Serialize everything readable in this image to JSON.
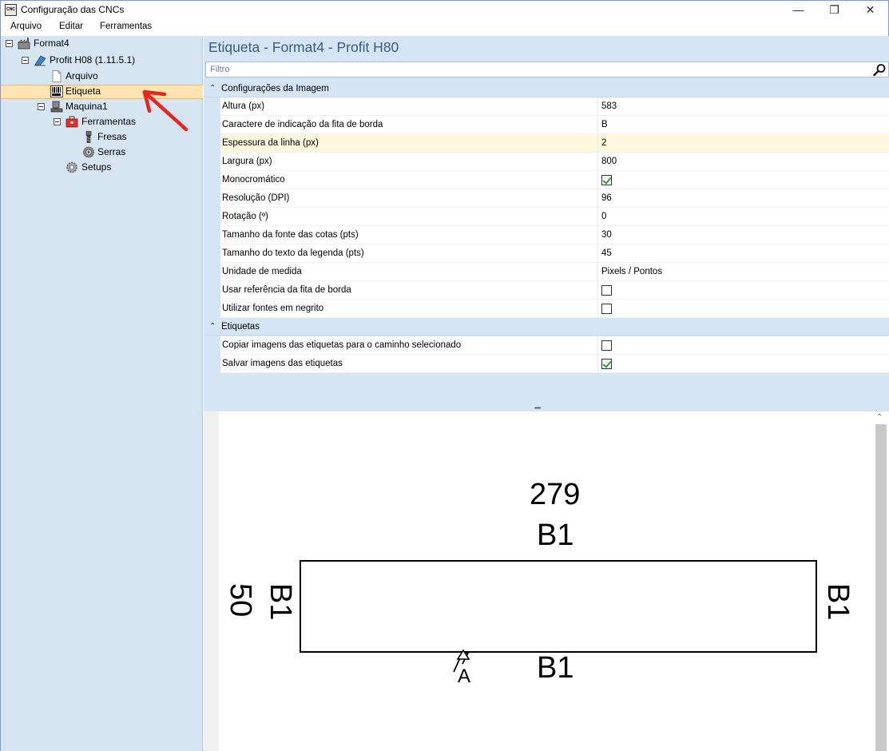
{
  "window": {
    "title": "Configuração das CNCs",
    "icon_text": "CNC"
  },
  "menu": {
    "items": [
      "Arquivo",
      "Editar",
      "Ferramentas"
    ]
  },
  "tree": {
    "root": "Format4",
    "machine_profile": "Profit H08 (1.11.5.1)",
    "arquivo": "Arquivo",
    "etiqueta": "Etiqueta",
    "maquina": "Maquina1",
    "ferramentas": "Ferramentas",
    "fresas": "Fresas",
    "serras": "Serras",
    "setups": "Setups"
  },
  "panel": {
    "title": "Etiqueta - Format4 - Profit H80",
    "filter_placeholder": "Filtro"
  },
  "properties": {
    "categories": [
      "Configurações da Imagem",
      "Etiquetas"
    ],
    "image": [
      {
        "name": "Altura (px)",
        "value": "583"
      },
      {
        "name": "Caractere de indicação da fita de borda",
        "value": "B"
      },
      {
        "name": "Espessura da linha (px)",
        "value": "2"
      },
      {
        "name": "Largura (px)",
        "value": "800"
      },
      {
        "name": "Monocromático",
        "value": ""
      },
      {
        "name": "Resolução (DPI)",
        "value": "96"
      },
      {
        "name": "Rotação (º)",
        "value": "0"
      },
      {
        "name": "Tamanho da fonte das cotas (pts)",
        "value": "30"
      },
      {
        "name": "Tamanho do texto da legenda (pts)",
        "value": "45"
      },
      {
        "name": "Unidade de medida",
        "value": "Pixels / Pontos"
      },
      {
        "name": "Usar referência da fita de borda",
        "value": ""
      },
      {
        "name": "Utilizar fontes em negrito",
        "value": ""
      }
    ],
    "labels": [
      {
        "name": "Copiar imagens das etiquetas para o caminho selecionado",
        "value": ""
      },
      {
        "name": "Salvar imagens das etiquetas",
        "value": ""
      }
    ],
    "checked": {
      "monocromatico": true,
      "usar_referencia": false,
      "utilizar_negrito": false,
      "copiar_imagens": false,
      "salvar_imagens": true
    }
  },
  "preview": {
    "width_dim": "279",
    "height_dim": "50",
    "edge_top": "B1",
    "edge_bottom": "B1",
    "edge_left": "B1",
    "edge_right": "B1",
    "grain_letter": "A"
  },
  "colors": {
    "tree_bg": "#d7e4f2",
    "selection": "#fde4b2",
    "title_blue": "#3a5a82",
    "annotation_red": "#e8241c"
  }
}
